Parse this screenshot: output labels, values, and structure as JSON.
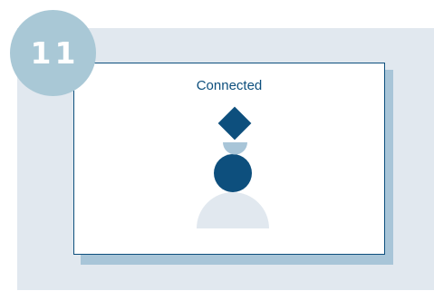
{
  "step": {
    "number": "11"
  },
  "card": {
    "status": "Connected"
  },
  "illustration": {
    "shapes": [
      "diamond",
      "half-circle-bowl",
      "circle",
      "semicircle-base"
    ],
    "colors": {
      "primary": "#0d4f7d",
      "secondary": "#a8c5d8",
      "light": "#e1e8ef"
    }
  }
}
